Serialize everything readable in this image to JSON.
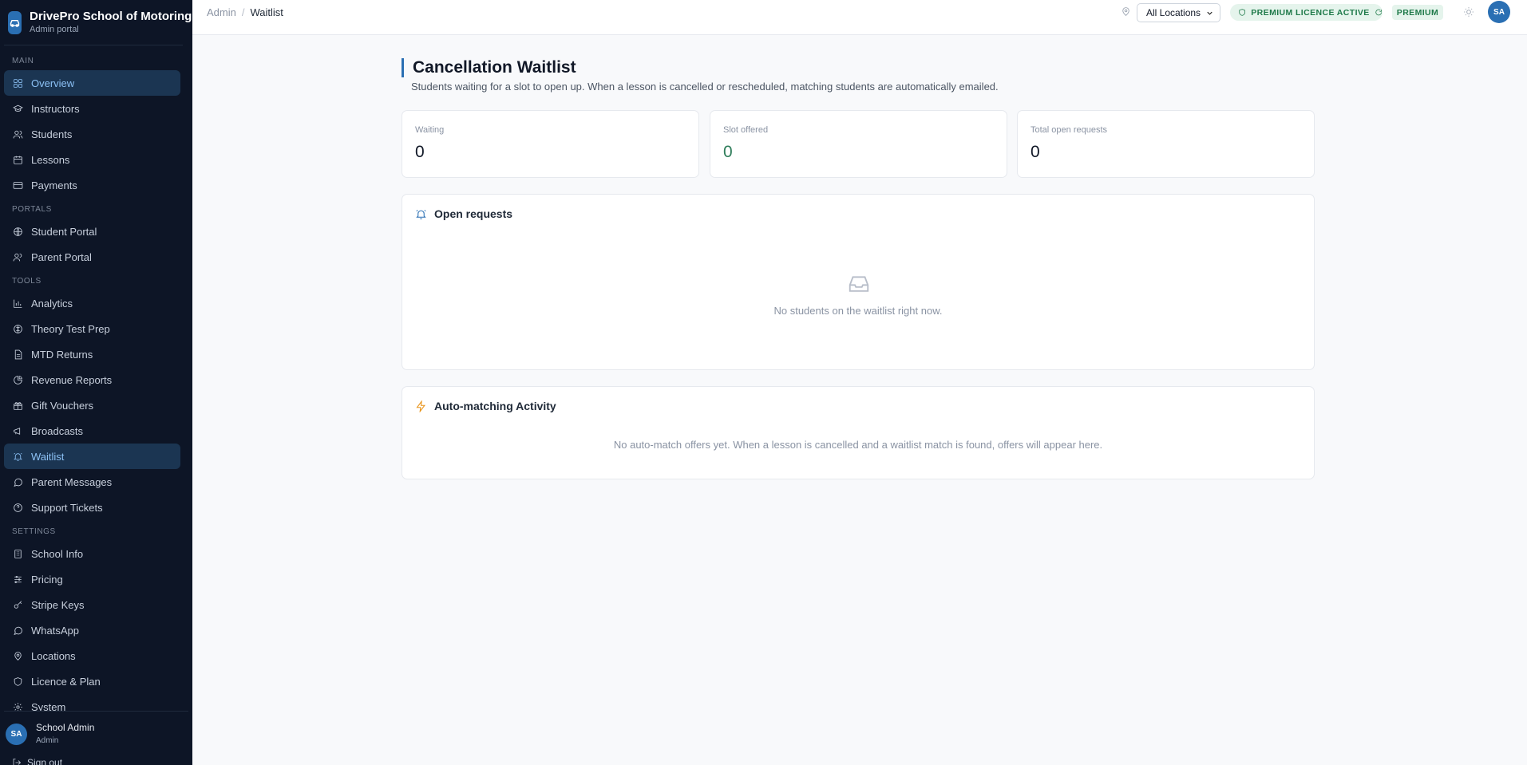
{
  "brand": {
    "name": "DrivePro School of Motoring",
    "subtitle": "Admin portal"
  },
  "sidebar": {
    "sections": {
      "main": "MAIN",
      "portals": "PORTALS",
      "tools": "TOOLS",
      "settings": "SETTINGS"
    },
    "main": [
      {
        "label": "Overview",
        "icon": "grid-icon"
      },
      {
        "label": "Instructors",
        "icon": "graduation-cap-icon"
      },
      {
        "label": "Students",
        "icon": "users-icon"
      },
      {
        "label": "Lessons",
        "icon": "calendar-icon"
      },
      {
        "label": "Payments",
        "icon": "credit-card-icon"
      }
    ],
    "portals": [
      {
        "label": "Student Portal",
        "icon": "globe-icon"
      },
      {
        "label": "Parent Portal",
        "icon": "users-icon"
      }
    ],
    "tools": [
      {
        "label": "Analytics",
        "icon": "bar-chart-icon"
      },
      {
        "label": "Theory Test Prep",
        "icon": "brain-icon"
      },
      {
        "label": "MTD Returns",
        "icon": "file-text-icon"
      },
      {
        "label": "Revenue Reports",
        "icon": "pie-chart-icon"
      },
      {
        "label": "Gift Vouchers",
        "icon": "gift-icon"
      },
      {
        "label": "Broadcasts",
        "icon": "megaphone-icon"
      },
      {
        "label": "Waitlist",
        "icon": "bell-ring-icon"
      },
      {
        "label": "Parent Messages",
        "icon": "message-circle-icon"
      },
      {
        "label": "Support Tickets",
        "icon": "help-circle-icon"
      }
    ],
    "settings": [
      {
        "label": "School Info",
        "icon": "building-icon"
      },
      {
        "label": "Pricing",
        "icon": "sliders-icon"
      },
      {
        "label": "Stripe Keys",
        "icon": "key-icon"
      },
      {
        "label": "WhatsApp",
        "icon": "message-circle-icon"
      },
      {
        "label": "Locations",
        "icon": "map-pin-icon"
      },
      {
        "label": "Licence & Plan",
        "icon": "shield-icon"
      },
      {
        "label": "System",
        "icon": "settings-icon"
      }
    ],
    "active_item": "Waitlist",
    "highlighted_item": "Overview",
    "user": {
      "initials": "SA",
      "name": "School Admin",
      "role": "Admin"
    },
    "sign_out": "Sign out"
  },
  "topbar": {
    "breadcrumb_root": "Admin",
    "breadcrumb_separator": "/",
    "breadcrumb_current": "Waitlist",
    "location_select": "All Locations",
    "licence_badge": "PREMIUM LICENCE ACTIVE",
    "plan_badge": "PREMIUM",
    "avatar_initials": "SA"
  },
  "page": {
    "title": "Cancellation Waitlist",
    "subtitle": "Students waiting for a slot to open up. When a lesson is cancelled or rescheduled, matching students are automatically emailed."
  },
  "stats": [
    {
      "label": "Waiting",
      "value": "0"
    },
    {
      "label": "Slot offered",
      "value": "0"
    },
    {
      "label": "Total open requests",
      "value": "0"
    }
  ],
  "open_requests": {
    "title": "Open requests",
    "empty_text": "No students on the waitlist right now."
  },
  "auto_matching": {
    "title": "Auto-matching Activity",
    "empty_text": "No auto-match offers yet. When a lesson is cancelled and a waitlist match is found, offers will appear here."
  },
  "colors": {
    "sidebar_bg": "#0d1526",
    "accent": "#2a6fb3",
    "active_nav_bg": "#1b3552",
    "success_text": "#1f7a4a",
    "success_bg": "#e5f4ec",
    "warning_icon": "#e8941a"
  }
}
